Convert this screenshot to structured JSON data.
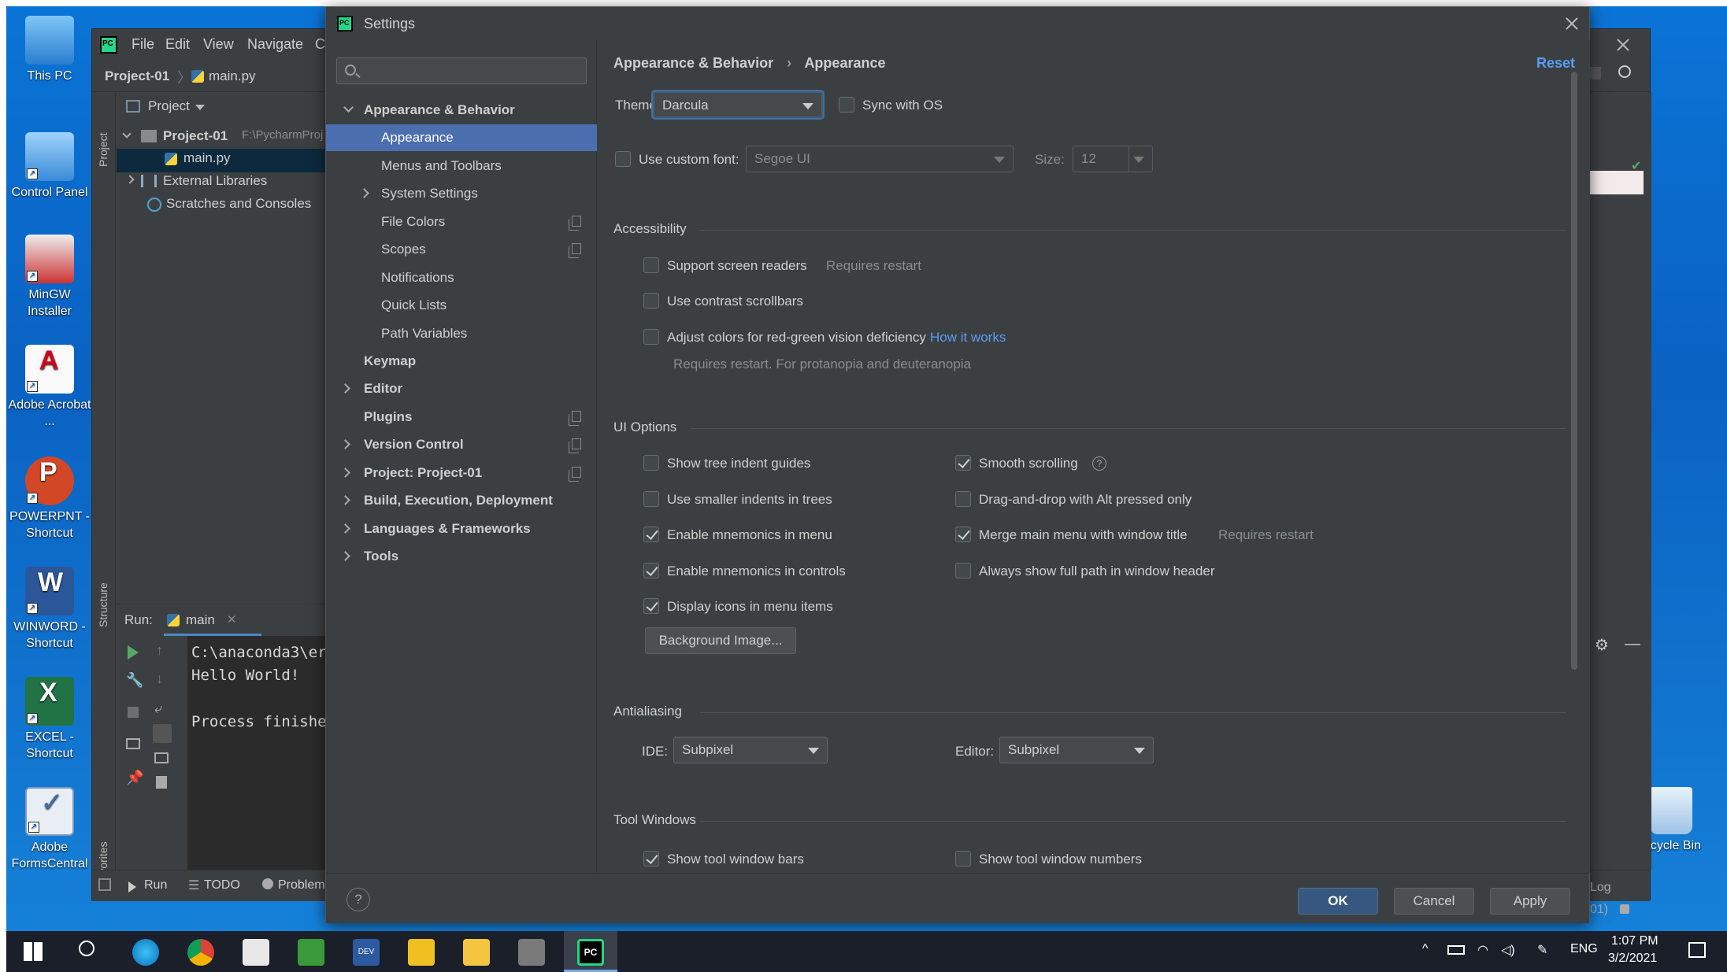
{
  "desktop": {
    "icons": [
      {
        "label": "This PC"
      },
      {
        "label": "Control Panel"
      },
      {
        "label": "MinGW Installer"
      },
      {
        "label": "Adobe Acrobat ..."
      },
      {
        "label": "POWERPNT - Shortcut"
      },
      {
        "label": "WINWORD - Shortcut"
      },
      {
        "label": "EXCEL - Shortcut"
      },
      {
        "label": "Adobe FormsCentral"
      },
      {
        "label": "ecycle Bin"
      }
    ]
  },
  "ide": {
    "menu": [
      "File",
      "Edit",
      "View",
      "Navigate",
      "C"
    ],
    "breadcrumb": {
      "project": "Project-01",
      "file": "main.py"
    },
    "sidetabs": {
      "project": "Project",
      "structure": "Structure",
      "favorites": "Favorites"
    },
    "project_view_label": "Project",
    "tree": {
      "root": "Project-01",
      "root_path": "F:\\PycharmProj",
      "file": "main.py",
      "external": "External Libraries",
      "scratches": "Scratches and Consoles"
    },
    "run": {
      "label": "Run:",
      "tab": "main",
      "lines": [
        "C:\\anaconda3\\er",
        "Hello World!",
        "",
        "Process finishe"
      ]
    },
    "status": {
      "run": "Run",
      "todo": "TODO",
      "problems": "Problem"
    },
    "right_fragments": {
      "log": "Log",
      "line": "01)"
    }
  },
  "settings": {
    "title": "Settings",
    "search_placeholder": "",
    "nav": [
      {
        "label": "Appearance & Behavior",
        "bold": true,
        "expanded": true
      },
      {
        "label": "Appearance",
        "selected": true
      },
      {
        "label": "Menus and Toolbars"
      },
      {
        "label": "System Settings",
        "collapsible": true
      },
      {
        "label": "File Colors",
        "copy": true
      },
      {
        "label": "Scopes",
        "copy": true
      },
      {
        "label": "Notifications"
      },
      {
        "label": "Quick Lists"
      },
      {
        "label": "Path Variables"
      },
      {
        "label": "Keymap",
        "bold": true
      },
      {
        "label": "Editor",
        "bold": true,
        "collapsible": true
      },
      {
        "label": "Plugins",
        "bold": true,
        "copy": true
      },
      {
        "label": "Version Control",
        "bold": true,
        "collapsible": true,
        "copy": true
      },
      {
        "label": "Project: Project-01",
        "bold": true,
        "collapsible": true,
        "copy": true
      },
      {
        "label": "Build, Execution, Deployment",
        "bold": true,
        "collapsible": true
      },
      {
        "label": "Languages & Frameworks",
        "bold": true,
        "collapsible": true
      },
      {
        "label": "Tools",
        "bold": true,
        "collapsible": true
      }
    ],
    "breadcrumb": {
      "parent": "Appearance & Behavior",
      "sep": "›",
      "current": "Appearance"
    },
    "reset": "Reset",
    "theme": {
      "label": "Theme:",
      "value": "Darcula",
      "sync_label": "Sync with OS",
      "sync_checked": false
    },
    "font": {
      "label": "Use custom font:",
      "checked": false,
      "value": "Segoe UI",
      "size_label": "Size:",
      "size_value": "12"
    },
    "accessibility": {
      "title": "Accessibility",
      "screen_readers": {
        "label": "Support screen readers",
        "note": "Requires restart",
        "checked": false
      },
      "contrast": {
        "label": "Use contrast scrollbars",
        "checked": false
      },
      "redgreen": {
        "label": "Adjust colors for red-green vision deficiency",
        "link": "How it works",
        "note": "Requires restart. For protanopia and deuteranopia",
        "checked": false
      }
    },
    "ui_options": {
      "title": "UI Options",
      "left": [
        {
          "label": "Show tree indent guides",
          "checked": false
        },
        {
          "label": "Use smaller indents in trees",
          "checked": false
        },
        {
          "label": "Enable mnemonics in menu",
          "checked": true
        },
        {
          "label": "Enable mnemonics in controls",
          "checked": true
        },
        {
          "label": "Display icons in menu items",
          "checked": true
        }
      ],
      "right": [
        {
          "label": "Smooth scrolling",
          "checked": true,
          "help": "?"
        },
        {
          "label": "Drag-and-drop with Alt pressed only",
          "checked": false
        },
        {
          "label": "Merge main menu with window title",
          "checked": true,
          "note": "Requires restart"
        },
        {
          "label": "Always show full path in window header",
          "checked": false
        }
      ],
      "background_button": "Background Image..."
    },
    "antialiasing": {
      "title": "Antialiasing",
      "ide_label": "IDE:",
      "ide_value": "Subpixel",
      "editor_label": "Editor:",
      "editor_value": "Subpixel"
    },
    "tool_windows": {
      "title": "Tool Windows",
      "bars": {
        "label": "Show tool window bars",
        "checked": true
      },
      "numbers": {
        "label": "Show tool window numbers",
        "checked": false
      }
    },
    "footer": {
      "help": "?",
      "ok": "OK",
      "cancel": "Cancel",
      "apply": "Apply"
    }
  },
  "taskbar": {
    "lang": "ENG",
    "time": "1:07 PM",
    "date": "3/2/2021"
  },
  "colors": {
    "accent": "#4b6eaf",
    "link": "#589df6",
    "dialog_bg": "#3c3f41",
    "desktop": "#0a6ecb"
  }
}
